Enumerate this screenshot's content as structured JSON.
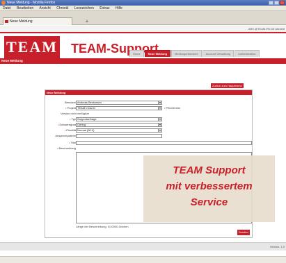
{
  "window": {
    "title": "Neue Meldung - Mozilla Firefox"
  },
  "menu": [
    "Datei",
    "Bearbeiten",
    "Ansicht",
    "Chronik",
    "Lesezeichen",
    "Extras",
    "Hilfe"
  ],
  "browser_tab": {
    "label": "Neue Meldung",
    "new_tab": "+"
  },
  "user_info": "ABS @TEAM-PB.DE Abmeld",
  "logo": "TEAM",
  "brand": "TEAM-Support",
  "nav": [
    "Home",
    "Neue Meldung",
    "Meldungsübersicht",
    "Account-Verwaltung",
    "Administration"
  ],
  "page_bar": "Neue Meldung",
  "back_button": "Zurück zum Hauptmenü",
  "form": {
    "header": "Neue Meldung",
    "benutzer_label": "Benutzer",
    "benutzer_value": "Andreas Beckmann",
    "projekt_label": "Projekt",
    "projekt_value": "TEAM Intranet",
    "pflicht": "Pflichtfelder",
    "version_text": "Version nicht verfügbar",
    "typ_label": "Typ",
    "typ_value": "Supportanfrage",
    "schwere_label": "Schweregrad",
    "schwere_value": "Gering",
    "prio_label": "Priorität",
    "prio_value": "Normal (50.0)",
    "ansprech_label": "Ansprechpartner",
    "titel_label": "Titel",
    "beschreibung_label": "Beschreibung",
    "laenge": "Länge der Beschreibung: 0/10000 Zeichen",
    "send": "Senden"
  },
  "overlay": {
    "line1": "TEAM Support",
    "line2": "mit verbessertem",
    "line3": "Service"
  },
  "footer": {
    "version": "Version: 1.0"
  },
  "colors": {
    "brand_red": "#c8202a"
  }
}
